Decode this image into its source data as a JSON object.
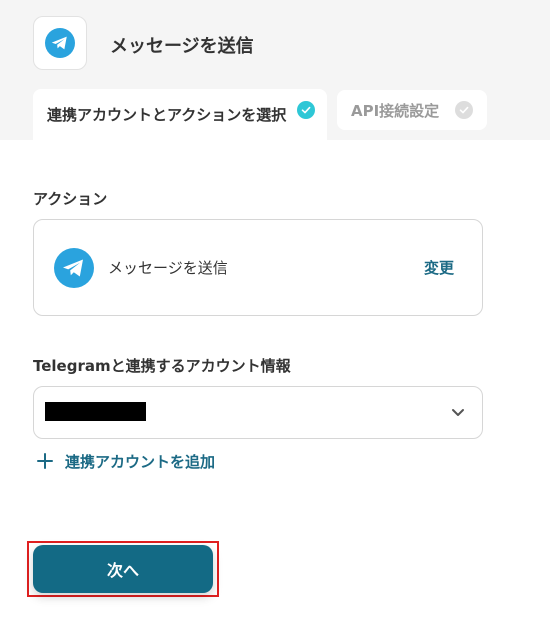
{
  "header": {
    "title": "メッセージを送信",
    "app_icon": "telegram-icon"
  },
  "tabs": [
    {
      "label": "連携アカウントとアクションを選択",
      "state": "completed",
      "icon": "check-circle-icon"
    },
    {
      "label": "API接続設定",
      "state": "pending",
      "icon": "check-circle-icon"
    }
  ],
  "action_section": {
    "label": "アクション",
    "card": {
      "icon": "telegram-icon",
      "action_name": "メッセージを送信",
      "change_label": "変更"
    }
  },
  "account_section": {
    "label": "Telegramと連携するアカウント情報",
    "selected_value_redacted": true,
    "add_account_label": "連携アカウントを追加"
  },
  "footer": {
    "next_label": "次へ"
  },
  "colors": {
    "accent": "#136a85",
    "link": "#1c6a85",
    "check_done": "#2ec7d6",
    "telegram": "#2aa3de",
    "highlight": "#e02020"
  }
}
